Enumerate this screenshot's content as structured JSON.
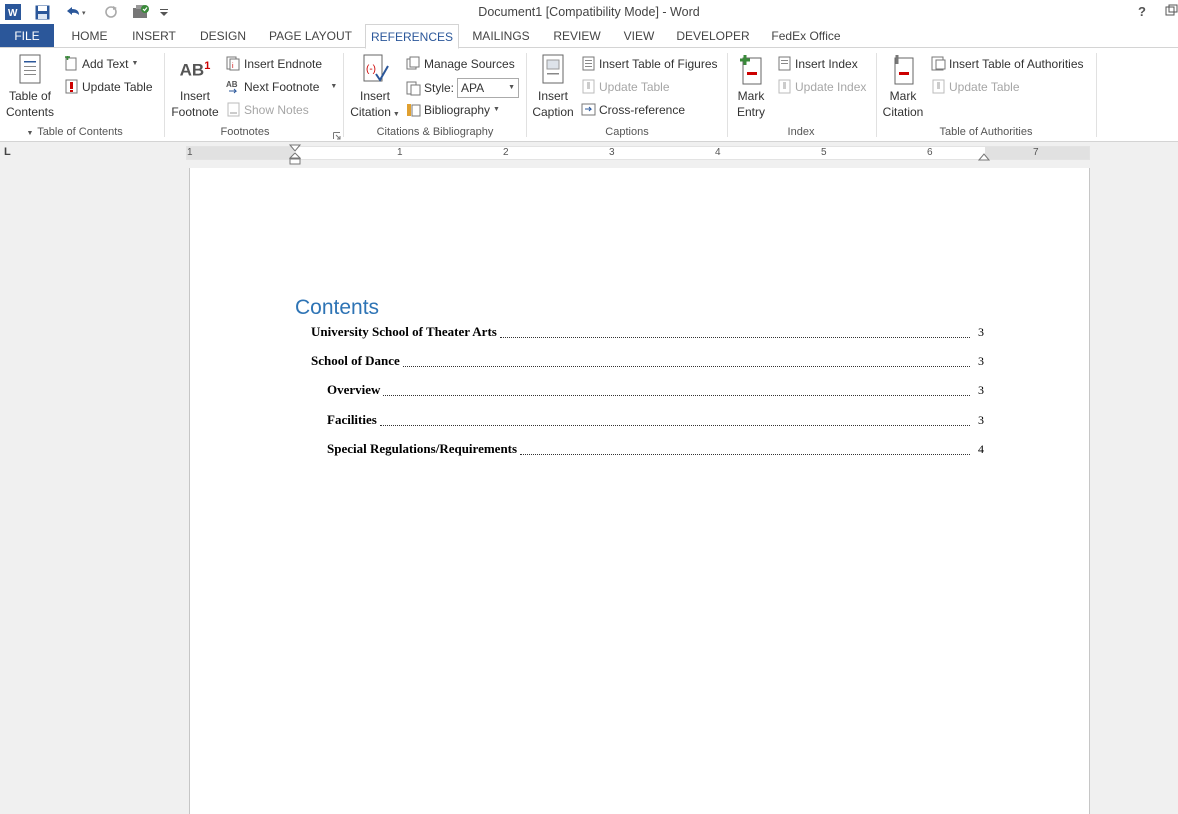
{
  "window": {
    "title": "Document1 [Compatibility Mode] - Word",
    "help": "?",
    "restore_icon": "restore-icon"
  },
  "quick_access": [
    "word-logo-icon",
    "save-icon",
    "undo-icon",
    "redo-icon",
    "touch-mode-icon",
    "customize-icon"
  ],
  "tabs": [
    {
      "label": "FILE"
    },
    {
      "label": "HOME"
    },
    {
      "label": "INSERT"
    },
    {
      "label": "DESIGN"
    },
    {
      "label": "PAGE LAYOUT"
    },
    {
      "label": "REFERENCES"
    },
    {
      "label": "MAILINGS"
    },
    {
      "label": "REVIEW"
    },
    {
      "label": "VIEW"
    },
    {
      "label": "DEVELOPER"
    },
    {
      "label": "FedEx Office"
    }
  ],
  "active_tab": "REFERENCES",
  "ribbon": {
    "toc": {
      "big_line1": "Table of",
      "big_line2": "Contents",
      "add_text": "Add Text",
      "update_table": "Update Table",
      "label": "Table of Contents"
    },
    "footnotes": {
      "big_line1": "Insert",
      "big_line2": "Footnote",
      "insert_endnote": "Insert Endnote",
      "next_footnote": "Next Footnote",
      "show_notes": "Show Notes",
      "label": "Footnotes",
      "ab_glyph": "AB",
      "sup_glyph": "1"
    },
    "citations": {
      "big_line1": "Insert",
      "big_line2": "Citation",
      "manage_sources": "Manage Sources",
      "style_label": "Style:",
      "style_value": "APA",
      "bibliography": "Bibliography",
      "label": "Citations & Bibliography"
    },
    "captions": {
      "big_line1": "Insert",
      "big_line2": "Caption",
      "insert_tof": "Insert Table of Figures",
      "update_table": "Update Table",
      "cross_reference": "Cross-reference",
      "label": "Captions"
    },
    "index": {
      "big_line1": "Mark",
      "big_line2": "Entry",
      "insert_index": "Insert Index",
      "update_index": "Update Index",
      "label": "Index"
    },
    "authorities": {
      "big_line1": "Mark",
      "big_line2": "Citation",
      "insert_toa": "Insert Table of Authorities",
      "update_table": "Update Table",
      "label": "Table of Authorities"
    }
  },
  "ruler": {
    "numbers": [
      "1",
      "1",
      "2",
      "3",
      "4",
      "5",
      "6",
      "7"
    ],
    "tab_selector": "L"
  },
  "document": {
    "toc_title": "Contents",
    "entries": [
      {
        "text": "University School of Theater Arts",
        "page": "3",
        "level": 1
      },
      {
        "text": "School of Dance",
        "page": "3",
        "level": 1
      },
      {
        "text": "Overview",
        "page": "3",
        "level": 2
      },
      {
        "text": "Facilities",
        "page": "3",
        "level": 2
      },
      {
        "text": "Special Regulations/Requirements",
        "page": "4",
        "level": 2
      }
    ]
  },
  "colors": {
    "accent": "#2b579a",
    "heading": "#2e74b5"
  }
}
